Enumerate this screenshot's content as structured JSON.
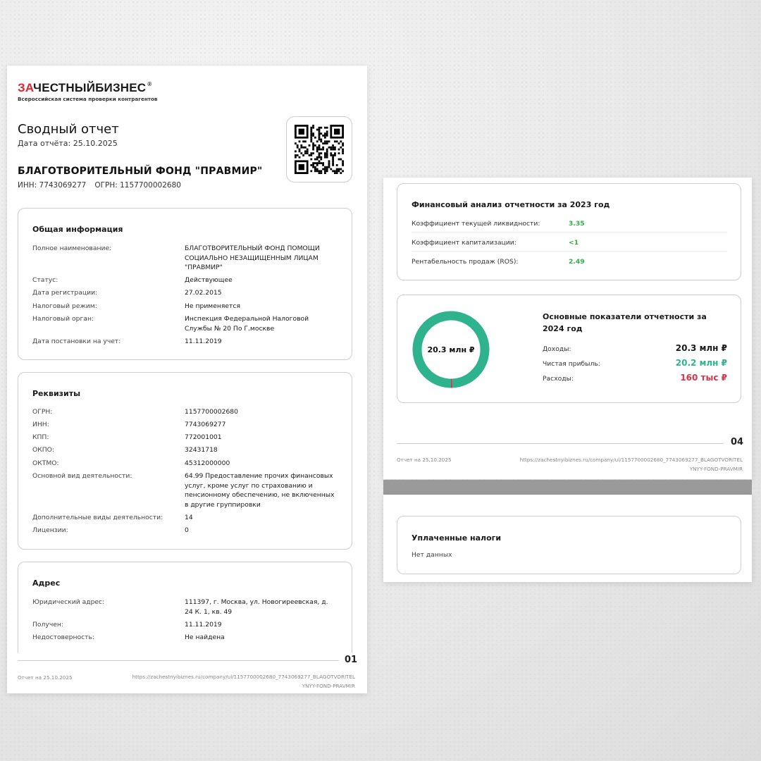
{
  "page1": {
    "logo": {
      "prefix": "ЗА",
      "rest": "ЧЕСТНЫЙБИЗНЕС",
      "reg": "®",
      "subtitle": "Всероссийская система проверки контрагентов"
    },
    "title": "Сводный отчет",
    "report_date": "Дата отчёта: 25.10.2025",
    "company_name": "БЛАГОТВОРИТЕЛЬНЫЙ ФОНД \"ПРАВМИР\"",
    "inn": "ИНН: 7743069277",
    "ogrn": "ОГРН: 1157700002680",
    "general": {
      "title": "Общая информация",
      "rows": [
        {
          "label": "Полное наименование:",
          "value": "БЛАГОТВОРИТЕЛЬНЫЙ ФОНД ПОМОЩИ СОЦИАЛЬНО НЕЗАЩИЩЕННЫМ ЛИЦАМ \"ПРАВМИР\""
        },
        {
          "label": "Статус:",
          "value": "Действующее"
        },
        {
          "label": "Дата регистрации:",
          "value": "27.02.2015"
        },
        {
          "label": "Налоговый режим:",
          "value": "Не применяется"
        },
        {
          "label": "Налоговый орган:",
          "value": "Инспекция Федеральной Налоговой Службы № 20 По Г.москве"
        },
        {
          "label": "Дата постановки на учет:",
          "value": "11.11.2019"
        }
      ]
    },
    "requisites": {
      "title": "Реквизиты",
      "rows": [
        {
          "label": "ОГРН:",
          "value": "1157700002680"
        },
        {
          "label": "ИНН:",
          "value": "7743069277"
        },
        {
          "label": "КПП:",
          "value": "772001001"
        },
        {
          "label": "ОКПО:",
          "value": "32431718"
        },
        {
          "label": "ОКТМО:",
          "value": "45312000000"
        },
        {
          "label": "Основной вид деятельности:",
          "value": "64.99 Предоставление прочих финансовых услуг, кроме услуг по страхованию и пенсионному обеспечению, не включенных в другие группировки"
        },
        {
          "label": "Дополнительные виды деятельности:",
          "value": "14"
        },
        {
          "label": "Лицензии:",
          "value": "0"
        }
      ]
    },
    "address": {
      "title": "Адрес",
      "rows": [
        {
          "label": "Юридический адрес:",
          "value": "111397, г. Москва, ул. Новогиреевская, д. 24 К. 1, кв. 49"
        },
        {
          "label": "Получен:",
          "value": "11.11.2019"
        },
        {
          "label": "Недостоверность:",
          "value": "Не найдена"
        }
      ]
    },
    "footer": {
      "page_num": "01",
      "left": "Отчет на 25.10.2025",
      "url_line1": "https://zachestnyibiznes.ru/company/ul/1157700002680_7743069277_BLAGOTVORITEL",
      "url_line2": "YNYY-FOND-PRAVMIR"
    }
  },
  "page2": {
    "fin_analysis": {
      "title": "Финансовый анализ отчетности за 2023 год",
      "rows": [
        {
          "label": "Коэффициент текущей ликвидности:",
          "value": "3.35"
        },
        {
          "label": "Коэффициент капитализации:",
          "value": "<1"
        },
        {
          "label": "Рентабельность продаж (ROS):",
          "value": "2.49"
        }
      ]
    },
    "kpi": {
      "title": "Основные показатели отчетности за 2024 год",
      "donut_label": "20.3 млн ₽",
      "income_label": "Доходы:",
      "income_value": "20.3 млн ₽",
      "profit_label": "Чистая прибыль:",
      "profit_value": "20.2 млн ₽",
      "expense_label": "Расходы:",
      "expense_value": "160 тыс ₽",
      "donut_share_profit": 0.992,
      "colors": {
        "profit": "#2fb38f",
        "expense": "#d8364b",
        "income": "#1a1a1a"
      }
    },
    "footer": {
      "page_num": "04",
      "left": "Отчет на 25.10.2025",
      "url_line1": "https://zachestnyibiznes.ru/company/ul/1157700002680_7743069277_BLAGOTVORITEL",
      "url_line2": "YNYY-FOND-PRAVMIR"
    }
  },
  "page3": {
    "taxes_title": "Уплаченные налоги",
    "taxes_value": "Нет данных"
  }
}
